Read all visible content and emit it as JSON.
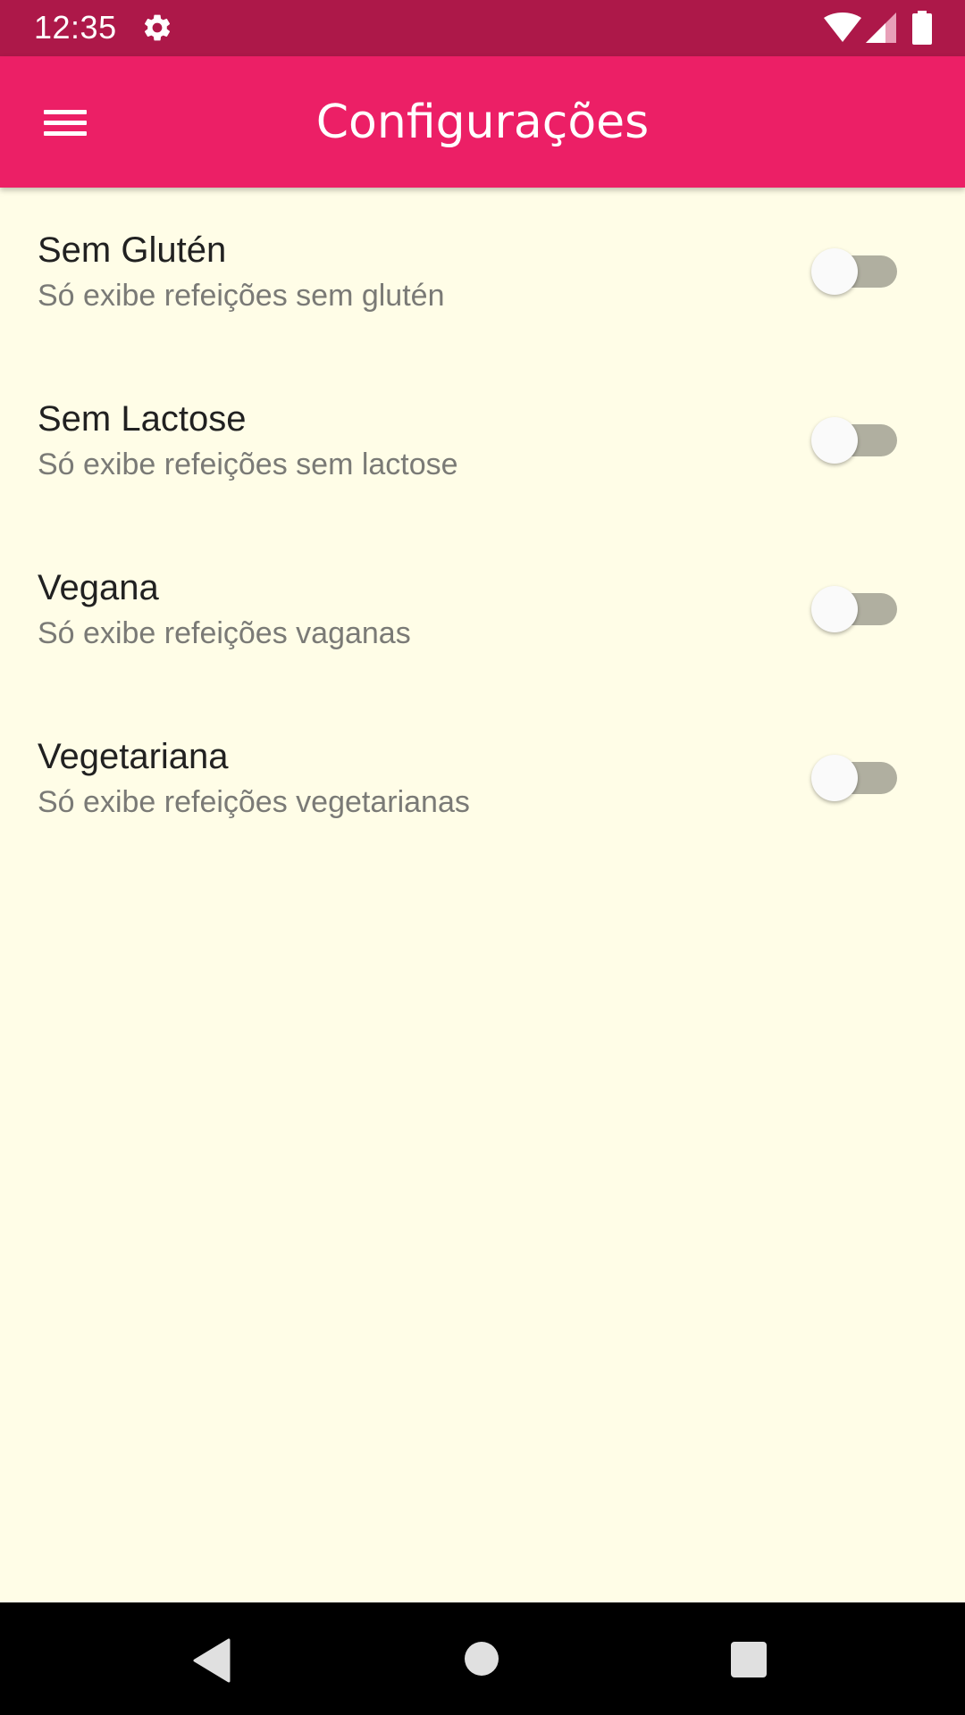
{
  "status_bar": {
    "time": "12:35",
    "icons": [
      "gear-icon",
      "wifi-icon",
      "cell-signal-icon",
      "battery-icon"
    ],
    "background": "#AD1849"
  },
  "app_bar": {
    "title": "Configurações",
    "menu_icon": "hamburger-menu-icon",
    "background": "#EC1F66"
  },
  "settings": {
    "items": [
      {
        "title": "Sem Glutén",
        "subtitle": "Só exibe refeições sem glutén",
        "enabled": false
      },
      {
        "title": "Sem Lactose",
        "subtitle": "Só exibe refeições sem lactose",
        "enabled": false
      },
      {
        "title": "Vegana",
        "subtitle": "Só exibe refeições vaganas",
        "enabled": false
      },
      {
        "title": "Vegetariana",
        "subtitle": "Só exibe refeições vegetarianas",
        "enabled": false
      }
    ],
    "background": "#FFFDE7"
  },
  "nav_bar": {
    "icons": [
      "back-icon",
      "home-icon",
      "recents-icon"
    ]
  }
}
